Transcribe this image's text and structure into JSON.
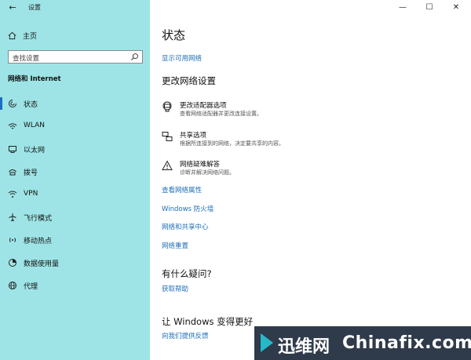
{
  "window": {
    "app_title": "设置",
    "back_glyph": "←",
    "min_glyph": "—",
    "max_glyph": "☐",
    "close_glyph": "✕"
  },
  "sidebar": {
    "home_label": "主页",
    "search_placeholder": "查找设置",
    "section_title": "网络和 Internet",
    "items": [
      {
        "label": "状态",
        "icon": "status-icon",
        "active": true
      },
      {
        "label": "WLAN",
        "icon": "wifi-icon",
        "active": false
      },
      {
        "label": "以太网",
        "icon": "ethernet-icon",
        "active": false
      },
      {
        "label": "拨号",
        "icon": "dialup-icon",
        "active": false
      },
      {
        "label": "VPN",
        "icon": "vpn-icon",
        "active": false
      },
      {
        "label": "飞行模式",
        "icon": "airplane-icon",
        "active": false
      },
      {
        "label": "移动热点",
        "icon": "hotspot-icon",
        "active": false
      },
      {
        "label": "数据使用量",
        "icon": "data-usage-icon",
        "active": false
      },
      {
        "label": "代理",
        "icon": "globe-icon",
        "active": false
      }
    ]
  },
  "main": {
    "title": "状态",
    "show_networks_link": "显示可用网络",
    "change_heading": "更改网络设置",
    "options": [
      {
        "title": "更改适配器选项",
        "desc": "查看网络适配器并更改连接设置。",
        "icon": "adapter-icon"
      },
      {
        "title": "共享选项",
        "desc": "根据所连接到的网络，决定要共享的内容。",
        "icon": "sharing-icon"
      },
      {
        "title": "网络疑难解答",
        "desc": "诊断并解决网络问题。",
        "icon": "warning-icon"
      }
    ],
    "links": [
      "查看网络属性",
      "Windows 防火墙",
      "网络和共享中心",
      "网络重置"
    ],
    "question_heading": "有什么疑问?",
    "help_link": "获取帮助",
    "improve_heading": "让 Windows 变得更好",
    "feedback_link": "向我们提供反馈"
  },
  "watermark": {
    "cn": "迅维网",
    "en": "Chinafix.com",
    "accent": "#25b9c8"
  }
}
